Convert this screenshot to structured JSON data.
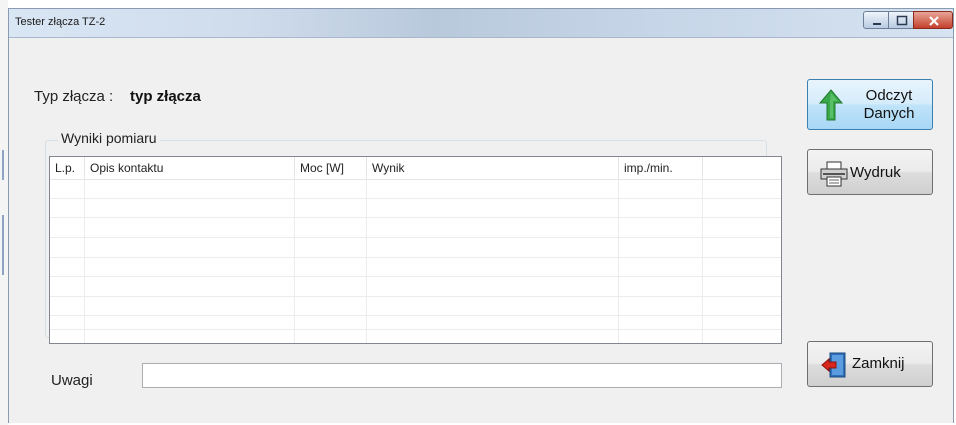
{
  "window": {
    "title": "Tester złącza TZ-2"
  },
  "connector": {
    "label": "Typ złącza :",
    "value": "typ złącza"
  },
  "results": {
    "group_title": "Wyniki pomiaru",
    "columns": [
      "L.p.",
      "Opis kontaktu",
      "Moc [W]",
      "Wynik",
      "imp./min.",
      ""
    ],
    "rows": []
  },
  "buttons": {
    "read": "Odczyt Danych",
    "print": "Wydruk",
    "close": "Zamknij"
  },
  "notes": {
    "label": "Uwagi",
    "value": ""
  },
  "icons": {
    "read": "green-up-arrow-icon",
    "print": "printer-icon",
    "close": "exit-door-icon"
  },
  "colors": {
    "active_button": "#bfe3f9",
    "close_button": "#c2402b",
    "arrow_green": "#3aa84a"
  }
}
